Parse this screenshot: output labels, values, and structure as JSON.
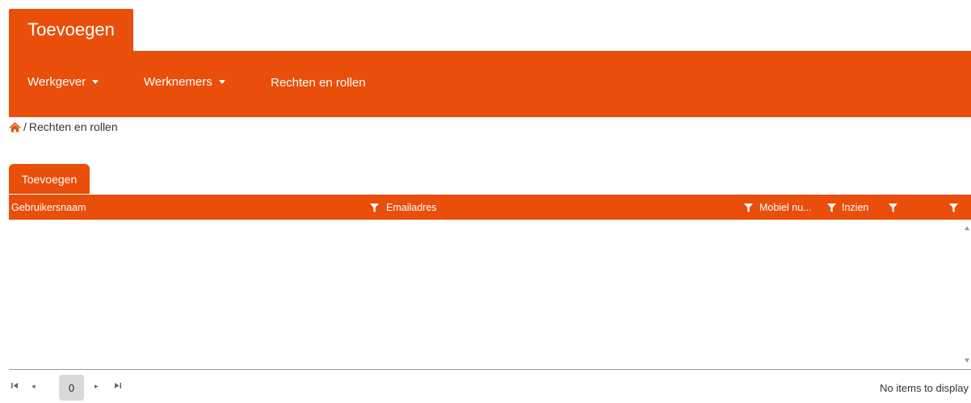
{
  "top_tab": {
    "label": "Toevoegen"
  },
  "navbar": {
    "items": [
      {
        "label": "Werkgever",
        "has_dropdown": true
      },
      {
        "label": "Werknemers",
        "has_dropdown": true
      },
      {
        "label": "Rechten en rollen",
        "has_dropdown": false
      }
    ]
  },
  "breadcrumb": {
    "separator": "/",
    "current": "Rechten en rollen",
    "home_icon": "home-icon"
  },
  "toolbar": {
    "add_label": "Toevoegen"
  },
  "grid": {
    "columns": [
      {
        "label": "Gebruikersnaam",
        "filterable": true
      },
      {
        "label": "Emailadres",
        "filterable": true
      },
      {
        "label": "Mobiel nu...",
        "filterable": true
      },
      {
        "label": "Inzien",
        "filterable": true
      },
      {
        "label": "",
        "filterable": true
      }
    ],
    "rows": []
  },
  "pager": {
    "current_page": "0",
    "info": "No items to display"
  },
  "colors": {
    "accent": "#e94e0a",
    "pager_active": "#d9d9d9"
  }
}
